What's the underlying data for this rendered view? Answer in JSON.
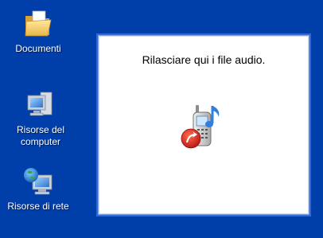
{
  "desktop": {
    "background_color": "#003fa9",
    "icons": [
      {
        "label": "Documenti",
        "icon": "folder-documents-icon"
      },
      {
        "label": "Risorse del computer",
        "icon": "my-computer-icon"
      },
      {
        "label": "Risorse di rete",
        "icon": "network-places-icon"
      }
    ]
  },
  "drop_panel": {
    "message": "Rilasciare qui i file audio.",
    "icon": "audio-phone-drop-icon"
  }
}
